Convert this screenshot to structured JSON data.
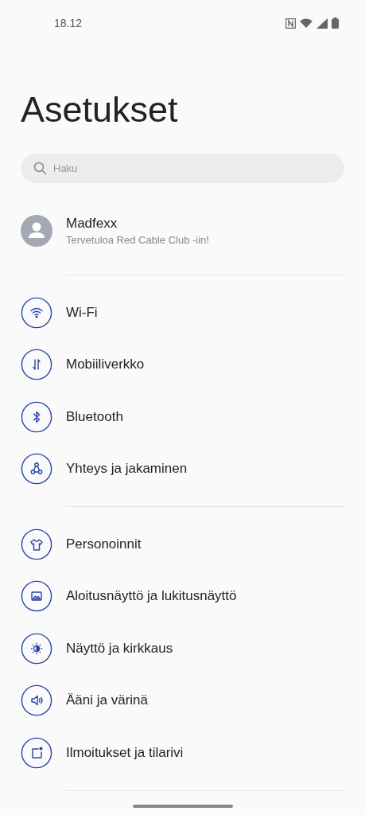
{
  "status_bar": {
    "time": "18.12"
  },
  "title": "Asetukset",
  "search": {
    "placeholder": "Haku"
  },
  "profile": {
    "name": "Madfexx",
    "subtitle": "Tervetuloa Red Cable Club -iin!"
  },
  "sections": [
    {
      "items": [
        {
          "label": "Wi-Fi"
        },
        {
          "label": "Mobiiliverkko"
        },
        {
          "label": "Bluetooth"
        },
        {
          "label": "Yhteys ja jakaminen"
        }
      ]
    },
    {
      "items": [
        {
          "label": "Personoinnit"
        },
        {
          "label": "Aloitusnäyttö ja lukitusnäyttö"
        },
        {
          "label": "Näyttö ja kirkkaus"
        },
        {
          "label": "Ääni ja värinä"
        },
        {
          "label": "Ilmoitukset ja tilarivi"
        }
      ]
    }
  ]
}
